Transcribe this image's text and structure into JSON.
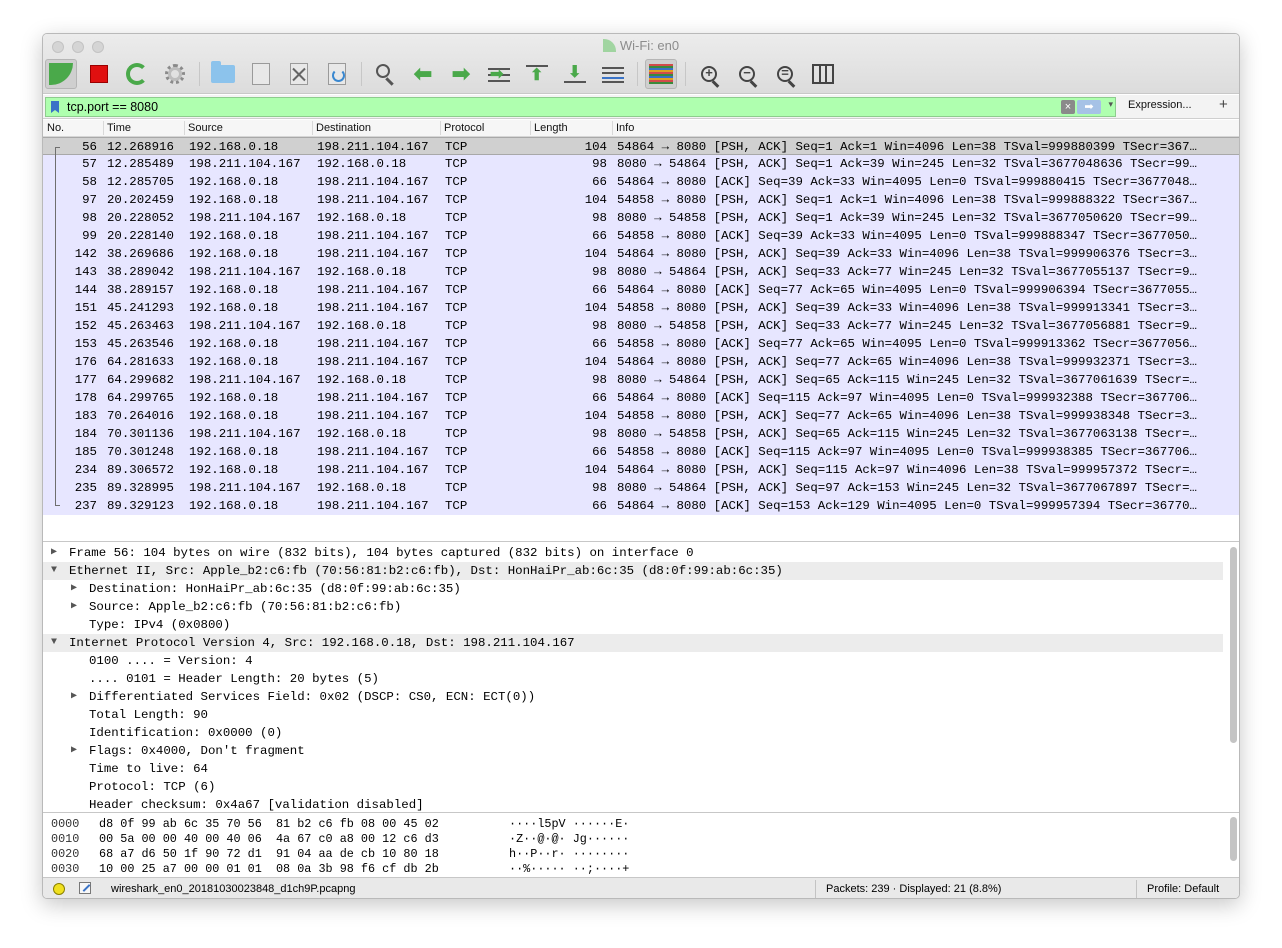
{
  "window": {
    "title": "Wi-Fi: en0"
  },
  "icons": {
    "start": "shark-fin-icon",
    "stop": "stop-icon",
    "restart": "restart-icon",
    "options": "gear-icon",
    "open": "folder-icon",
    "save": "file-icon",
    "close": "file-close-icon",
    "reload": "reload-icon",
    "find": "search-icon",
    "back": "arrow-left-icon",
    "forward": "arrow-right-icon",
    "goto": "goto-packet-icon",
    "first": "first-packet-icon",
    "last": "last-packet-icon",
    "autoscroll": "autoscroll-icon",
    "colorize": "colorize-icon",
    "zoom_in": "zoom-in-icon",
    "zoom_out": "zoom-out-icon",
    "zoom_reset": "zoom-reset-icon",
    "resize": "resize-columns-icon"
  },
  "filter": {
    "value": "tcp.port == 8080",
    "expression_label": "Expression...",
    "add_label": "+",
    "clear_label": "×",
    "apply_label": "➡",
    "dropdown_label": "▾",
    "bg_color": "#afffaf"
  },
  "columns": {
    "no": "No.",
    "time": "Time",
    "source": "Source",
    "destination": "Destination",
    "protocol": "Protocol",
    "length": "Length",
    "info": "Info"
  },
  "packets": [
    {
      "no": "56",
      "time": "12.268916",
      "src": "192.168.0.18",
      "dst": "198.211.104.167",
      "proto": "TCP",
      "len": "104",
      "info": "54864 → 8080 [PSH, ACK] Seq=1 Ack=1 Win=4096 Len=38 TSval=999880399 TSecr=367…"
    },
    {
      "no": "57",
      "time": "12.285489",
      "src": "198.211.104.167",
      "dst": "192.168.0.18",
      "proto": "TCP",
      "len": "98",
      "info": "8080 → 54864 [PSH, ACK] Seq=1 Ack=39 Win=245 Len=32 TSval=3677048636 TSecr=99…"
    },
    {
      "no": "58",
      "time": "12.285705",
      "src": "192.168.0.18",
      "dst": "198.211.104.167",
      "proto": "TCP",
      "len": "66",
      "info": "54864 → 8080 [ACK] Seq=39 Ack=33 Win=4095 Len=0 TSval=999880415 TSecr=3677048…"
    },
    {
      "no": "97",
      "time": "20.202459",
      "src": "192.168.0.18",
      "dst": "198.211.104.167",
      "proto": "TCP",
      "len": "104",
      "info": "54858 → 8080 [PSH, ACK] Seq=1 Ack=1 Win=4096 Len=38 TSval=999888322 TSecr=367…"
    },
    {
      "no": "98",
      "time": "20.228052",
      "src": "198.211.104.167",
      "dst": "192.168.0.18",
      "proto": "TCP",
      "len": "98",
      "info": "8080 → 54858 [PSH, ACK] Seq=1 Ack=39 Win=245 Len=32 TSval=3677050620 TSecr=99…"
    },
    {
      "no": "99",
      "time": "20.228140",
      "src": "192.168.0.18",
      "dst": "198.211.104.167",
      "proto": "TCP",
      "len": "66",
      "info": "54858 → 8080 [ACK] Seq=39 Ack=33 Win=4095 Len=0 TSval=999888347 TSecr=3677050…"
    },
    {
      "no": "142",
      "time": "38.269686",
      "src": "192.168.0.18",
      "dst": "198.211.104.167",
      "proto": "TCP",
      "len": "104",
      "info": "54864 → 8080 [PSH, ACK] Seq=39 Ack=33 Win=4096 Len=38 TSval=999906376 TSecr=3…"
    },
    {
      "no": "143",
      "time": "38.289042",
      "src": "198.211.104.167",
      "dst": "192.168.0.18",
      "proto": "TCP",
      "len": "98",
      "info": "8080 → 54864 [PSH, ACK] Seq=33 Ack=77 Win=245 Len=32 TSval=3677055137 TSecr=9…"
    },
    {
      "no": "144",
      "time": "38.289157",
      "src": "192.168.0.18",
      "dst": "198.211.104.167",
      "proto": "TCP",
      "len": "66",
      "info": "54864 → 8080 [ACK] Seq=77 Ack=65 Win=4095 Len=0 TSval=999906394 TSecr=3677055…"
    },
    {
      "no": "151",
      "time": "45.241293",
      "src": "192.168.0.18",
      "dst": "198.211.104.167",
      "proto": "TCP",
      "len": "104",
      "info": "54858 → 8080 [PSH, ACK] Seq=39 Ack=33 Win=4096 Len=38 TSval=999913341 TSecr=3…"
    },
    {
      "no": "152",
      "time": "45.263463",
      "src": "198.211.104.167",
      "dst": "192.168.0.18",
      "proto": "TCP",
      "len": "98",
      "info": "8080 → 54858 [PSH, ACK] Seq=33 Ack=77 Win=245 Len=32 TSval=3677056881 TSecr=9…"
    },
    {
      "no": "153",
      "time": "45.263546",
      "src": "192.168.0.18",
      "dst": "198.211.104.167",
      "proto": "TCP",
      "len": "66",
      "info": "54858 → 8080 [ACK] Seq=77 Ack=65 Win=4095 Len=0 TSval=999913362 TSecr=3677056…"
    },
    {
      "no": "176",
      "time": "64.281633",
      "src": "192.168.0.18",
      "dst": "198.211.104.167",
      "proto": "TCP",
      "len": "104",
      "info": "54864 → 8080 [PSH, ACK] Seq=77 Ack=65 Win=4096 Len=38 TSval=999932371 TSecr=3…"
    },
    {
      "no": "177",
      "time": "64.299682",
      "src": "198.211.104.167",
      "dst": "192.168.0.18",
      "proto": "TCP",
      "len": "98",
      "info": "8080 → 54864 [PSH, ACK] Seq=65 Ack=115 Win=245 Len=32 TSval=3677061639 TSecr=…"
    },
    {
      "no": "178",
      "time": "64.299765",
      "src": "192.168.0.18",
      "dst": "198.211.104.167",
      "proto": "TCP",
      "len": "66",
      "info": "54864 → 8080 [ACK] Seq=115 Ack=97 Win=4095 Len=0 TSval=999932388 TSecr=367706…"
    },
    {
      "no": "183",
      "time": "70.264016",
      "src": "192.168.0.18",
      "dst": "198.211.104.167",
      "proto": "TCP",
      "len": "104",
      "info": "54858 → 8080 [PSH, ACK] Seq=77 Ack=65 Win=4096 Len=38 TSval=999938348 TSecr=3…"
    },
    {
      "no": "184",
      "time": "70.301136",
      "src": "198.211.104.167",
      "dst": "192.168.0.18",
      "proto": "TCP",
      "len": "98",
      "info": "8080 → 54858 [PSH, ACK] Seq=65 Ack=115 Win=245 Len=32 TSval=3677063138 TSecr=…"
    },
    {
      "no": "185",
      "time": "70.301248",
      "src": "192.168.0.18",
      "dst": "198.211.104.167",
      "proto": "TCP",
      "len": "66",
      "info": "54858 → 8080 [ACK] Seq=115 Ack=97 Win=4095 Len=0 TSval=999938385 TSecr=367706…"
    },
    {
      "no": "234",
      "time": "89.306572",
      "src": "192.168.0.18",
      "dst": "198.211.104.167",
      "proto": "TCP",
      "len": "104",
      "info": "54864 → 8080 [PSH, ACK] Seq=115 Ack=97 Win=4096 Len=38 TSval=999957372 TSecr=…"
    },
    {
      "no": "235",
      "time": "89.328995",
      "src": "198.211.104.167",
      "dst": "192.168.0.18",
      "proto": "TCP",
      "len": "98",
      "info": "8080 → 54864 [PSH, ACK] Seq=97 Ack=153 Win=245 Len=32 TSval=3677067897 TSecr=…"
    },
    {
      "no": "237",
      "time": "89.329123",
      "src": "192.168.0.18",
      "dst": "198.211.104.167",
      "proto": "TCP",
      "len": "66",
      "info": "54864 → 8080 [ACK] Seq=153 Ack=129 Win=4095 Len=0 TSval=999957394 TSecr=36770…"
    }
  ],
  "details": [
    {
      "text": "Frame 56: 104 bytes on wire (832 bits), 104 bytes captured (832 bits) on interface 0",
      "level": 0,
      "toggle": "collapsed",
      "shade": false
    },
    {
      "text": "Ethernet II, Src: Apple_b2:c6:fb (70:56:81:b2:c6:fb), Dst: HonHaiPr_ab:6c:35 (d8:0f:99:ab:6c:35)",
      "level": 0,
      "toggle": "expanded",
      "shade": true
    },
    {
      "text": "Destination: HonHaiPr_ab:6c:35 (d8:0f:99:ab:6c:35)",
      "level": 1,
      "toggle": "collapsed",
      "shade": false
    },
    {
      "text": "Source: Apple_b2:c6:fb (70:56:81:b2:c6:fb)",
      "level": 1,
      "toggle": "collapsed",
      "shade": false
    },
    {
      "text": "Type: IPv4 (0x0800)",
      "level": 1,
      "toggle": "none",
      "shade": false
    },
    {
      "text": "Internet Protocol Version 4, Src: 192.168.0.18, Dst: 198.211.104.167",
      "level": 0,
      "toggle": "expanded",
      "shade": true
    },
    {
      "text": "0100 .... = Version: 4",
      "level": 1,
      "toggle": "none",
      "shade": false
    },
    {
      "text": ".... 0101 = Header Length: 20 bytes (5)",
      "level": 1,
      "toggle": "none",
      "shade": false
    },
    {
      "text": "Differentiated Services Field: 0x02 (DSCP: CS0, ECN: ECT(0))",
      "level": 1,
      "toggle": "collapsed",
      "shade": false
    },
    {
      "text": "Total Length: 90",
      "level": 1,
      "toggle": "none",
      "shade": false
    },
    {
      "text": "Identification: 0x0000 (0)",
      "level": 1,
      "toggle": "none",
      "shade": false
    },
    {
      "text": "Flags: 0x4000, Don't fragment",
      "level": 1,
      "toggle": "collapsed",
      "shade": false
    },
    {
      "text": "Time to live: 64",
      "level": 1,
      "toggle": "none",
      "shade": false
    },
    {
      "text": "Protocol: TCP (6)",
      "level": 1,
      "toggle": "none",
      "shade": false
    },
    {
      "text": "Header checksum: 0x4a67 [validation disabled]",
      "level": 1,
      "toggle": "none",
      "shade": false
    }
  ],
  "bytes": [
    {
      "offset": "0000",
      "hex": "d8 0f 99 ab 6c 35 70 56  81 b2 c6 fb 08 00 45 02",
      "ascii": "····l5pV ······E·"
    },
    {
      "offset": "0010",
      "hex": "00 5a 00 00 40 00 40 06  4a 67 c0 a8 00 12 c6 d3",
      "ascii": "·Z··@·@· Jg······"
    },
    {
      "offset": "0020",
      "hex": "68 a7 d6 50 1f 90 72 d1  91 04 aa de cb 10 80 18",
      "ascii": "h··P··r· ········"
    },
    {
      "offset": "0030",
      "hex": "10 00 25 a7 00 00 01 01  08 0a 3b 98 f6 cf db 2b",
      "ascii": "··%····· ··;····+"
    }
  ],
  "status": {
    "file": "wireshark_en0_20181030023848_d1ch9P.pcapng",
    "packets": "Packets: 239 · Displayed: 21 (8.8%)",
    "profile": "Profile: Default"
  },
  "colors": {
    "row_bg": "#e7e6ff",
    "selected_bg": "#d0d0d0",
    "filter_ok": "#afffaf",
    "capture_green": "#4aa94a",
    "stop_red": "#e01010"
  }
}
